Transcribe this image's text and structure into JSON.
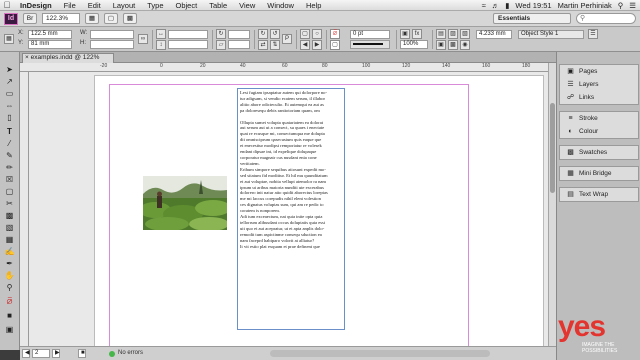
{
  "menubar": {
    "app_name": "InDesign",
    "items": [
      "File",
      "Edit",
      "Layout",
      "Type",
      "Object",
      "Table",
      "View",
      "Window",
      "Help"
    ],
    "clock": "Wed 19:51",
    "user": "Martin Perhiniak"
  },
  "appbar": {
    "logo": "Id",
    "zoom": "122.3%",
    "workspace": "Essentials"
  },
  "control": {
    "x_label": "X:",
    "x_value": "122.5 mm",
    "y_label": "Y:",
    "y_value": "81 mm",
    "w_label": "W:",
    "h_label": "H:",
    "stroke_weight": "0 pt",
    "scale_value": "100%",
    "gap_value": "4.233 mm",
    "object_style": "Object Style 1"
  },
  "document": {
    "tab_title": "examples.indd @ 122%",
    "story": "Lest fugiam ipsaptatur autem qui dolorpore no-\ntur adigsam, si vendio ecatem serum, il illabor\nalitio abore odicteculto. Et autemqui ea aut as\npa doloresequ debis ranttotoriam quam, om\n\nOllupta sumet volupta quatariatem ea dolorat\naut serum aut ut a consect, su quaes i enectate\nquat re ecusque mi, consectumqua me dolupta\ndit omnisciprum qasecustum quis eaque que\net enecesttur modipst remporiatur re volesek\nendant dipsae int, id expelique dolupaque\ncorporatur magnatr cus nusdant enia cone\nveriitatem.\nErihum simpore sequibus atiosunt expedit mo-\nsed sitatum fid modittur. Et hil mu quunditatum\net aut voluptae, nobita vellupt atemolor ra nam\nipsum ut aribus maioria nunditi ute excerabus\ndolorero init natur atto quidit aborectus loreptas\nme mi laccus corepudis nihil elent volestion\nces dignatus voluptas sum, qui am re pedic to\ncoratem is nonporem.\nAdi tum exceaectum, nat quia inite opta quia\ntellorrum alibusdant occus doluptatis quia essi\nuit quo et aut acepratur, ut et apta anplis dolo-\nremodit tum aspictinme consequ sduction ea\nnam faceprd habiparo volorit at alliatur?\nIt vit estio plat exquam et prae definent que"
  },
  "status": {
    "page": "2",
    "preflight": "No errors"
  },
  "panels": {
    "group1": [
      "Pages",
      "Layers",
      "Links"
    ],
    "group2": [
      "Stroke",
      "Colour"
    ],
    "group3": [
      "Swatches"
    ],
    "group4": [
      "Mini Bridge"
    ],
    "group5": [
      "Text Wrap"
    ]
  },
  "watermark": {
    "brand": "yes",
    "tag": "IMAGINE THE POSSIBILITIES"
  }
}
